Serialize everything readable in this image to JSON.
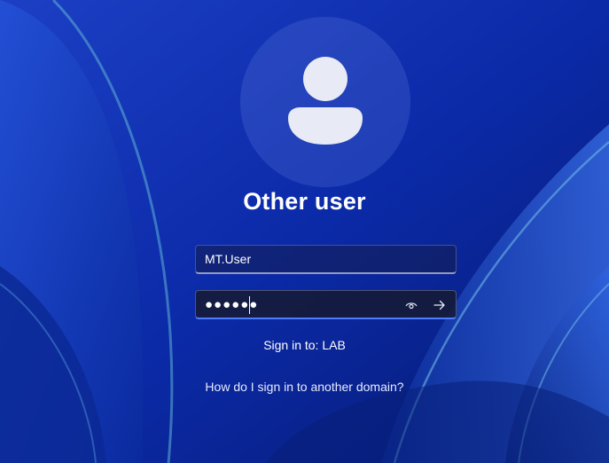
{
  "account": {
    "display_name": "Other user"
  },
  "login_form": {
    "username_value": "MT.User",
    "password_masked": "●●●●●●",
    "reveal_icon": "eye-icon",
    "submit_icon": "arrow-right-icon"
  },
  "sign_in_to": "Sign in to: LAB",
  "other_domain_link": "How do I sign in to another domain?",
  "colors": {
    "background": "#0a2a9e",
    "avatar_glyph": "#e8eaf5",
    "focus_accent": "#4f7cff"
  }
}
